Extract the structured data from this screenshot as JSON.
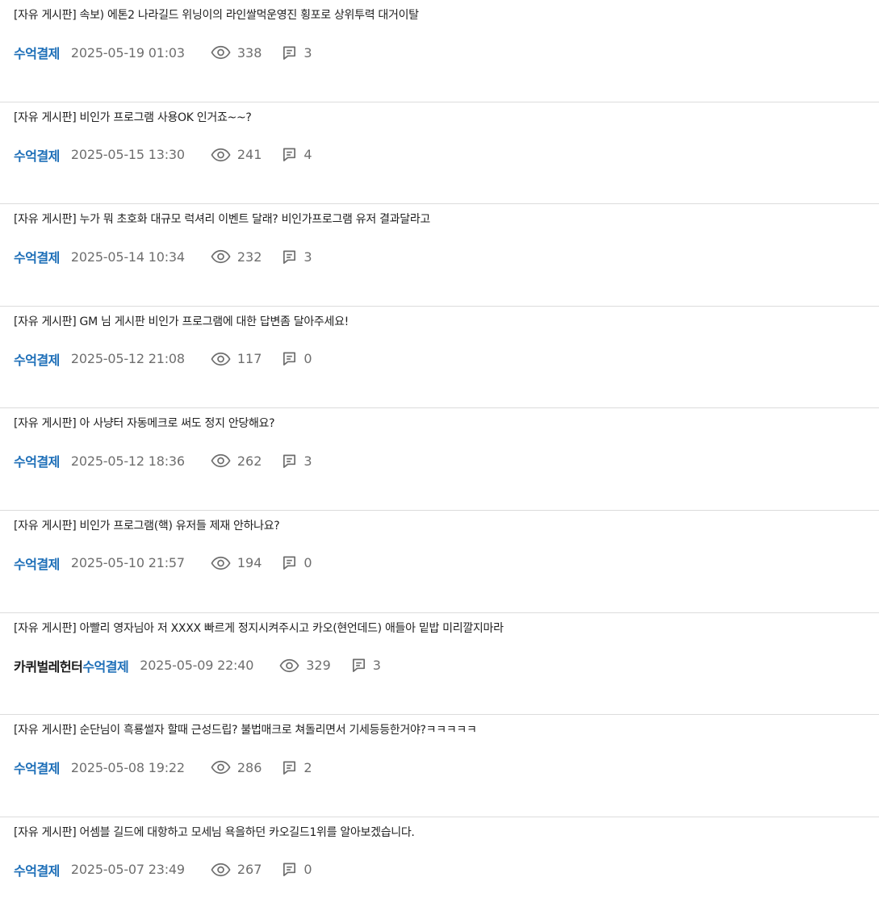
{
  "posts": [
    {
      "title": "[자유 게시판] 속보) 에톤2 나라길드 위닝이의 라인쌀먹운영진 횡포로 상위투력 대거이탈",
      "extra_tag": "",
      "author": "수억결제",
      "date": "2025-05-19 01:03",
      "views": "338",
      "comments": "3"
    },
    {
      "title": "[자유 게시판] 비인가 프로그램 사용OK 인거죠~~?",
      "extra_tag": "",
      "author": "수억결제",
      "date": "2025-05-15 13:30",
      "views": "241",
      "comments": "4"
    },
    {
      "title": "[자유 게시판] 누가 뭐 초호화 대규모 럭셔리 이벤트 달래? 비인가프로그램 유저 결과달라고",
      "extra_tag": "",
      "author": "수억결제",
      "date": "2025-05-14 10:34",
      "views": "232",
      "comments": "3"
    },
    {
      "title": "[자유 게시판] GM 님 게시판 비인가 프로그램에 대한 답변좀 달아주세요!",
      "extra_tag": "",
      "author": "수억결제",
      "date": "2025-05-12 21:08",
      "views": "117",
      "comments": "0"
    },
    {
      "title": "[자유 게시판] 아 사냥터 자동메크로 써도 정지 안당해요?",
      "extra_tag": "",
      "author": "수억결제",
      "date": "2025-05-12 18:36",
      "views": "262",
      "comments": "3"
    },
    {
      "title": "[자유 게시판] 비인가 프로그램(핵) 유저들 제재 안하나요?",
      "extra_tag": "",
      "author": "수억결제",
      "date": "2025-05-10 21:57",
      "views": "194",
      "comments": "0"
    },
    {
      "title": "[자유 게시판] 아빨리 영자님아 저 XXXX 빠르게 정지시켜주시고 카오(현언데드) 애들아 밑밥 미리깔지마라",
      "extra_tag": "카퀴벌레헌터",
      "author": "수억결제",
      "date": "2025-05-09 22:40",
      "views": "329",
      "comments": "3"
    },
    {
      "title": "[자유 게시판] 순단님이 흑룡썰자 할때 근성드립? 불법매크로 쳐돌리면서 기세등등한거야?ㅋㅋㅋㅋㅋ",
      "extra_tag": "",
      "author": "수억결제",
      "date": "2025-05-08 19:22",
      "views": "286",
      "comments": "2"
    },
    {
      "title": "[자유 게시판] 어셈블 길드에 대항하고 모세님 욕을하던 카오길드1위를 알아보겠습니다.",
      "extra_tag": "",
      "author": "수억결제",
      "date": "2025-05-07 23:49",
      "views": "267",
      "comments": "0"
    }
  ],
  "icons": {
    "views": "eye-icon",
    "comments": "comment-icon"
  },
  "colors": {
    "author": "#1e6fb8",
    "meta_text": "#6e6e6e",
    "divider": "#dcdcdc",
    "title_text": "#1f1f1f"
  }
}
